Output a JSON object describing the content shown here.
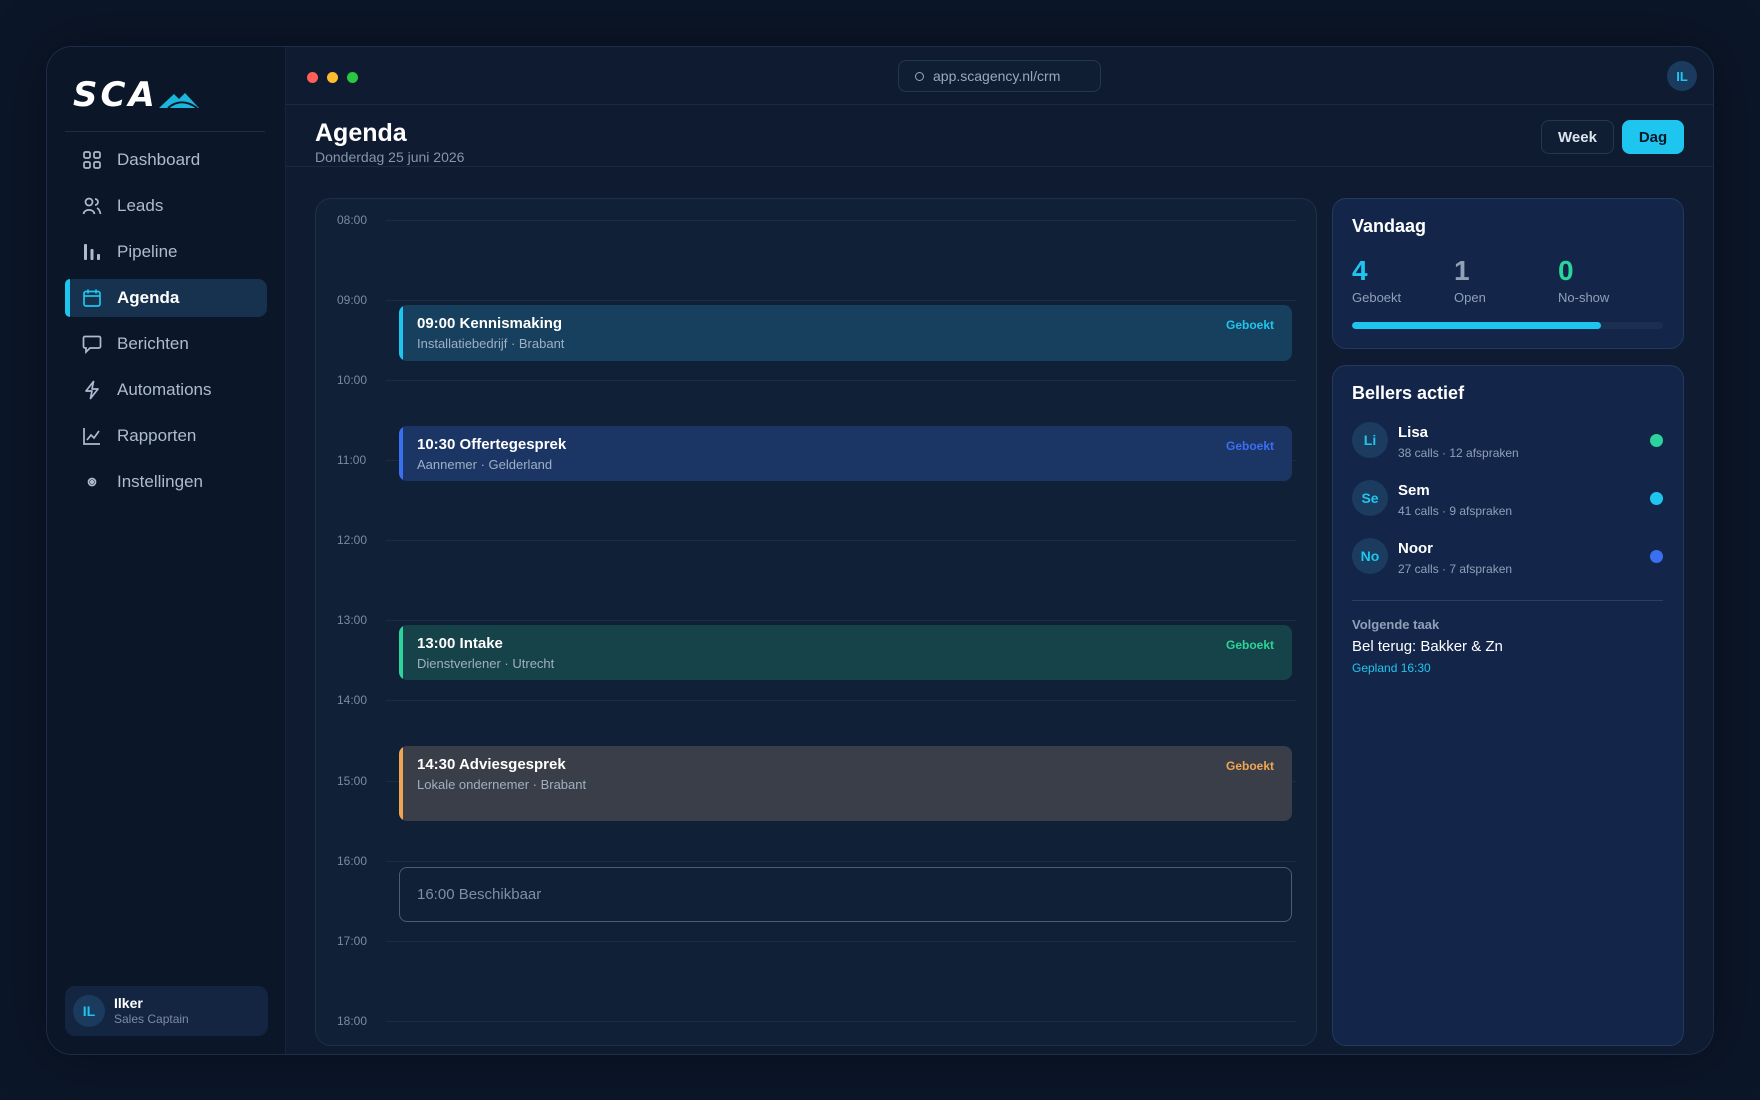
{
  "sidebar": {
    "logo_text": "SCA",
    "items": [
      {
        "label": "Dashboard",
        "icon": "grid-icon"
      },
      {
        "label": "Leads",
        "icon": "users-icon"
      },
      {
        "label": "Pipeline",
        "icon": "bars-icon"
      },
      {
        "label": "Agenda",
        "icon": "calendar-icon",
        "active": true
      },
      {
        "label": "Berichten",
        "icon": "message-icon"
      },
      {
        "label": "Automations",
        "icon": "bolt-icon"
      },
      {
        "label": "Rapporten",
        "icon": "chart-line-icon"
      },
      {
        "label": "Instellingen",
        "icon": "settings-icon"
      }
    ],
    "user": {
      "initials": "IL",
      "name": "Ilker",
      "role": "Sales Captain"
    }
  },
  "topbar": {
    "url": "app.scagency.nl/crm",
    "avatar_initials": "IL"
  },
  "header": {
    "title": "Agenda",
    "date": "Donderdag 25 juni 2026",
    "view_week": "Week",
    "view_day": "Dag",
    "active_view": "Dag"
  },
  "agenda": {
    "hours": [
      "08:00",
      "09:00",
      "10:00",
      "11:00",
      "12:00",
      "13:00",
      "14:00",
      "15:00",
      "16:00",
      "17:00",
      "18:00"
    ],
    "events": [
      {
        "title": "09:00  Kennismaking",
        "subtitle": "Installatiebedrijf · Brabant",
        "badge": "Geboekt",
        "color": "#1ec6ef"
      },
      {
        "title": "10:30  Offertegesprek",
        "subtitle": "Aannemer · Gelderland",
        "badge": "Geboekt",
        "color": "#3a6ff2"
      },
      {
        "title": "13:00  Intake",
        "subtitle": "Dienstverlener · Utrecht",
        "badge": "Geboekt",
        "color": "#2ad49a"
      },
      {
        "title": "14:30  Adviesgesprek",
        "subtitle": "Lokale ondernemer · Brabant",
        "badge": "Geboekt",
        "color": "#f0a552"
      }
    ],
    "available": "16:00  Beschikbaar"
  },
  "today": {
    "title": "Vandaag",
    "stats": [
      {
        "value": "4",
        "label": "Geboekt",
        "color": "#1ec6ef"
      },
      {
        "value": "1",
        "label": "Open",
        "color": "#8fa0b7"
      },
      {
        "value": "0",
        "label": "No-show",
        "color": "#2ad49a"
      }
    ],
    "progress": 0.8
  },
  "callers": {
    "title": "Bellers actief",
    "list": [
      {
        "initials": "Li",
        "name": "Lisa",
        "meta": "38 calls · 12 afspraken",
        "status_color": "#2ad49a"
      },
      {
        "initials": "Se",
        "name": "Sem",
        "meta": "41 calls · 9 afspraken",
        "status_color": "#1ec6ef"
      },
      {
        "initials": "No",
        "name": "Noor",
        "meta": "27 calls · 7 afspraken",
        "status_color": "#3a6ff2"
      }
    ],
    "next_label": "Volgende taak",
    "next_task": "Bel terug: Bakker & Zn",
    "next_time": "Gepland 16:30"
  }
}
